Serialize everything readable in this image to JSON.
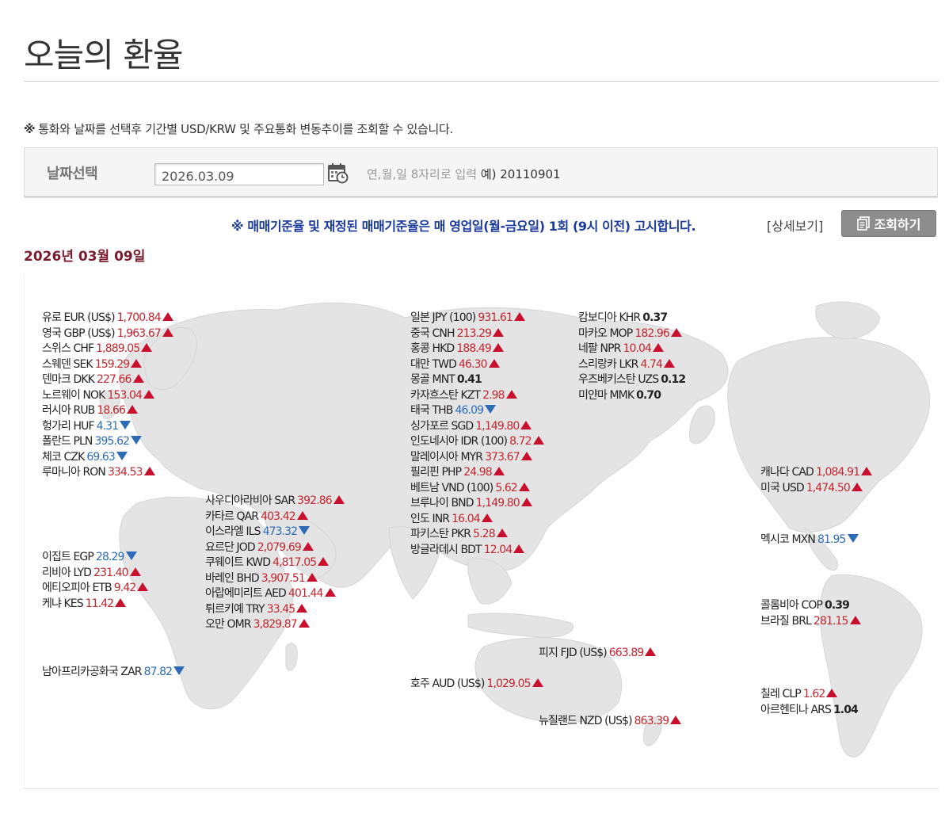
{
  "page": {
    "title": "오늘의 환율",
    "notice_mark": "※",
    "notice": "통화와 날짜를 선택후 기간별 USD/KRW 및 주요통화 변동추이를 조회할 수 있습니다.",
    "date_label": "날짜선택",
    "date_value": "2026.03.09",
    "date_hint": "연,월,일 8자리로 입력",
    "date_example": "예) 20110901",
    "info_text": "※ 매매기준율 및 재정된 매매기준율은 매 영업일(월-금요일) 1회 (9시 이전) 고시합니다.",
    "detail_link": "[상세보기]",
    "search_button": "조회하기",
    "date_heading": "2026년 03월 09일"
  },
  "colors": {
    "up": "#c2262e",
    "down": "#2d6bb8",
    "heading": "#7a1b2e",
    "info": "#1b3a9c",
    "map_land": "#e3e3e3"
  },
  "groups": {
    "europe": [
      {
        "label": "유로 EUR (US$)",
        "value": "1,700.84",
        "trend": "up"
      },
      {
        "label": "영국 GBP (US$)",
        "value": "1,963.67",
        "trend": "up"
      },
      {
        "label": "스위스 CHF",
        "value": "1,889.05",
        "trend": "up"
      },
      {
        "label": "스웨덴 SEK",
        "value": "159.29",
        "trend": "up"
      },
      {
        "label": "덴마크 DKK",
        "value": "227.66",
        "trend": "up"
      },
      {
        "label": "노르웨이 NOK",
        "value": "153.04",
        "trend": "up"
      },
      {
        "label": "러시아 RUB",
        "value": "18.66",
        "trend": "up"
      },
      {
        "label": "헝가리 HUF",
        "value": "4.31",
        "trend": "down"
      },
      {
        "label": "폴란드 PLN",
        "value": "395.62",
        "trend": "down"
      },
      {
        "label": "체코 CZK",
        "value": "69.63",
        "trend": "down"
      },
      {
        "label": "루마니아 RON",
        "value": "334.53",
        "trend": "up"
      }
    ],
    "africa": [
      {
        "label": "이집트 EGP",
        "value": "28.29",
        "trend": "down"
      },
      {
        "label": "리비아 LYD",
        "value": "231.40",
        "trend": "up"
      },
      {
        "label": "에티오피아 ETB",
        "value": "9.42",
        "trend": "up"
      },
      {
        "label": "케냐 KES",
        "value": "11.42",
        "trend": "up"
      }
    ],
    "south_africa": [
      {
        "label": "남아프리카공화국 ZAR",
        "value": "87.82",
        "trend": "down"
      }
    ],
    "middle_east": [
      {
        "label": "사우디아라비아 SAR",
        "value": "392.86",
        "trend": "up"
      },
      {
        "label": "카타르 QAR",
        "value": "403.42",
        "trend": "up"
      },
      {
        "label": "이스라엘 ILS",
        "value": "473.32",
        "trend": "down"
      },
      {
        "label": "요르단 JOD",
        "value": "2,079.69",
        "trend": "up"
      },
      {
        "label": "쿠웨이트 KWD",
        "value": "4,817.05",
        "trend": "up"
      },
      {
        "label": "바레인 BHD",
        "value": "3,907.51",
        "trend": "up"
      },
      {
        "label": "아랍에미리트 AED",
        "value": "401.44",
        "trend": "up"
      },
      {
        "label": "튀르키예 TRY",
        "value": "33.45",
        "trend": "up"
      },
      {
        "label": "오만 OMR",
        "value": "3,829.87",
        "trend": "up"
      }
    ],
    "asia1": [
      {
        "label": "일본 JPY (100)",
        "value": "931.61",
        "trend": "up"
      },
      {
        "label": "중국 CNH",
        "value": "213.29",
        "trend": "up"
      },
      {
        "label": "홍콩 HKD",
        "value": "188.49",
        "trend": "up"
      },
      {
        "label": "대만 TWD",
        "value": "46.30",
        "trend": "up"
      },
      {
        "label": "몽골 MNT",
        "value": "0.41",
        "trend": "none"
      },
      {
        "label": "카자흐스탄 KZT",
        "value": "2.98",
        "trend": "up"
      },
      {
        "label": "태국 THB",
        "value": "46.09",
        "trend": "down"
      },
      {
        "label": "싱가포르 SGD",
        "value": "1,149.80",
        "trend": "up"
      },
      {
        "label": "인도네시아 IDR (100)",
        "value": "8.72",
        "trend": "up"
      },
      {
        "label": "말레이시아 MYR",
        "value": "373.67",
        "trend": "up"
      },
      {
        "label": "필리핀 PHP",
        "value": "24.98",
        "trend": "up"
      },
      {
        "label": "베트남 VND (100)",
        "value": "5.62",
        "trend": "up"
      },
      {
        "label": "브루나이 BND",
        "value": "1,149.80",
        "trend": "up"
      },
      {
        "label": "인도 INR",
        "value": "16.04",
        "trend": "up"
      },
      {
        "label": "파키스탄 PKR",
        "value": "5.28",
        "trend": "up"
      },
      {
        "label": "방글라데시 BDT",
        "value": "12.04",
        "trend": "up"
      }
    ],
    "asia2": [
      {
        "label": "캄보디아 KHR",
        "value": "0.37",
        "trend": "none"
      },
      {
        "label": "마카오 MOP",
        "value": "182.96",
        "trend": "up"
      },
      {
        "label": "네팔 NPR",
        "value": "10.04",
        "trend": "up"
      },
      {
        "label": "스리랑카 LKR",
        "value": "4.74",
        "trend": "up"
      },
      {
        "label": "우즈베키스탄 UZS",
        "value": "0.12",
        "trend": "none"
      },
      {
        "label": "미얀마 MMK",
        "value": "0.70",
        "trend": "none"
      }
    ],
    "oceania_fiji": [
      {
        "label": "피지 FJD (US$)",
        "value": "663.89",
        "trend": "up"
      }
    ],
    "oceania_aud": [
      {
        "label": "호주 AUD (US$)",
        "value": "1,029.05",
        "trend": "up"
      }
    ],
    "oceania_nzd": [
      {
        "label": "뉴질랜드 NZD (US$)",
        "value": "863.39",
        "trend": "up"
      }
    ],
    "north_america": [
      {
        "label": "캐나다 CAD",
        "value": "1,084.91",
        "trend": "up"
      },
      {
        "label": "미국 USD",
        "value": "1,474.50",
        "trend": "up"
      }
    ],
    "mexico": [
      {
        "label": "멕시코 MXN",
        "value": "81.95",
        "trend": "down"
      }
    ],
    "south_america1": [
      {
        "label": "콜롬비아 COP",
        "value": "0.39",
        "trend": "none"
      },
      {
        "label": "브라질 BRL",
        "value": "281.15",
        "trend": "up"
      }
    ],
    "south_america2": [
      {
        "label": "칠레 CLP",
        "value": "1.62",
        "trend": "up"
      },
      {
        "label": "아르헨티나 ARS",
        "value": "1.04",
        "trend": "none"
      }
    ]
  }
}
